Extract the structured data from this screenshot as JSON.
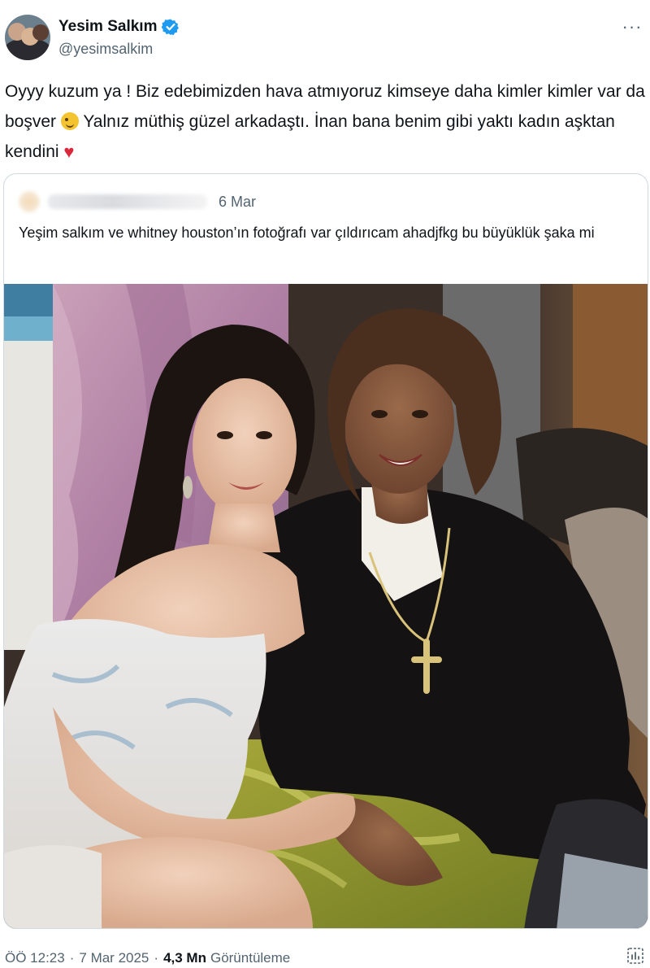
{
  "author": {
    "display_name": "Yesim Salkım",
    "handle": "@yesimsalkim",
    "verified": true
  },
  "more_icon": "more-horizontal-icon",
  "tweet": {
    "text_part1": "Oyyy kuzum ya ! Biz edebimizden hava atmıyoruz kimseye daha kimler kimler var da boşver",
    "emoji1": "winking-face-emoji",
    "text_part2": "Yalnız müthiş güzel arkadaştı. İnan bana benim gibi yaktı kadın aşktan kendini",
    "emoji2": "red-heart-emoji"
  },
  "quoted_tweet": {
    "date": "6 Mar",
    "text": "Yeşim salkım ve whitney houston’ın fotoğrafı var çıldırıcam ahadjfkg bu büyüklük şaka mi",
    "author_blurred": true
  },
  "footer": {
    "time": "ÖÖ 12:23",
    "date": "7 Mar 2025",
    "views_count": "4,3 Mn",
    "views_label": "Görüntüleme",
    "separator": "·"
  },
  "colors": {
    "text_primary": "#0f1419",
    "text_secondary": "#536471",
    "verified_blue": "#1d9bf0",
    "border": "#cfd9de",
    "heart": "#d8283a"
  }
}
